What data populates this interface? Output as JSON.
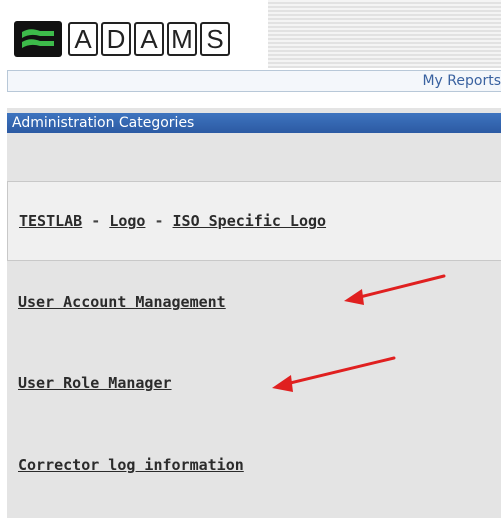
{
  "header": {
    "logo_text": "ADAMS",
    "logo_letters": [
      "A",
      "D",
      "A",
      "M",
      "S"
    ]
  },
  "reports_bar": {
    "link_label": "My Reports"
  },
  "categories": {
    "title": "Administration Categories"
  },
  "lab": {
    "name": "TESTLAB",
    "separator": " - ",
    "logo_link": "Logo",
    "iso_logo_link": "ISO Specific Logo"
  },
  "links": {
    "user_account": "User Account Management",
    "user_role": "User Role Manager",
    "corrector_log": "Corrector log information"
  },
  "colors": {
    "header_bar": "#3366b0",
    "content_bg": "#e4e4e4",
    "arrow": "#e02020",
    "link_blue": "#3a62a0"
  }
}
